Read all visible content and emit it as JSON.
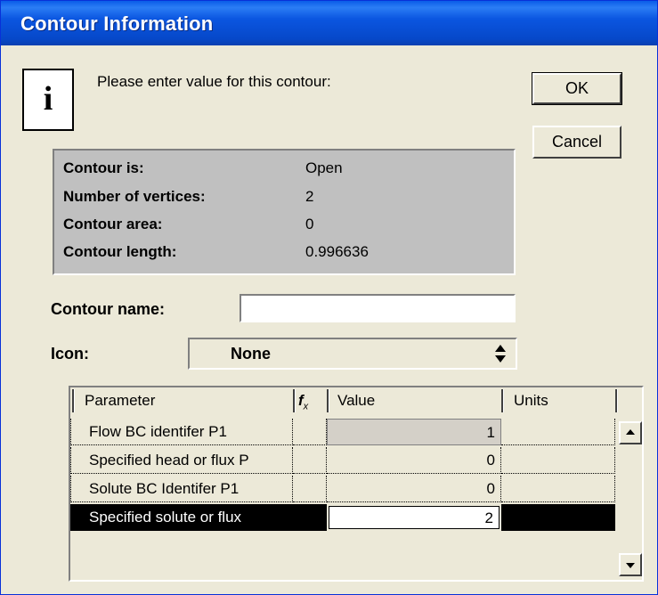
{
  "window": {
    "title": "Contour Information"
  },
  "prompt": {
    "text": "Please enter value for this contour:"
  },
  "buttons": {
    "ok": "OK",
    "cancel": "Cancel"
  },
  "info": {
    "rows": [
      {
        "label": "Contour is:",
        "value": "Open"
      },
      {
        "label": "Number of vertices:",
        "value": "2"
      },
      {
        "label": "Contour area:",
        "value": "0"
      },
      {
        "label": "Contour length:",
        "value": "0.996636"
      }
    ]
  },
  "contour_name": {
    "label": "Contour name:",
    "value": ""
  },
  "icon_select": {
    "label": "Icon:",
    "value": "None"
  },
  "grid": {
    "columns": {
      "parameter": "Parameter",
      "value": "Value",
      "units": "Units"
    },
    "rows": [
      {
        "parameter": "Flow BC identifer P1",
        "value": "1",
        "units": ""
      },
      {
        "parameter": "Specified head or flux P",
        "value": "0",
        "units": ""
      },
      {
        "parameter": "Solute BC Identifer P1",
        "value": "0",
        "units": ""
      },
      {
        "parameter": "Specified solute or flux",
        "value": "2",
        "units": ""
      }
    ]
  }
}
